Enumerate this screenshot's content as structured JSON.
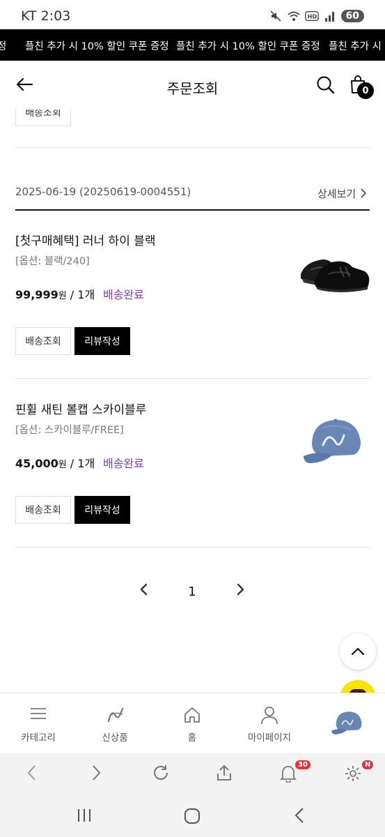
{
  "status_bar": {
    "time": "KT 2:03",
    "battery": "60"
  },
  "marquee": {
    "text": "플친 추가 시 10% 할인 쿠폰 증정",
    "left_fragment": "정",
    "right_fragment": "플친 추가 시 1"
  },
  "header": {
    "title": "주문조회",
    "cart_count": "0"
  },
  "top_partial_button": "배송조회",
  "order": {
    "date_label": "2025-06-19 (20250619-0004551)",
    "detail_link": "상세보기"
  },
  "items": [
    {
      "name": "[첫구매혜택] 러너 하이 블랙",
      "option": "[옵션: 블랙/240]",
      "price": "99,999",
      "currency": "원",
      "qty": " / 1개",
      "status": "배송완료",
      "track_label": "배송조회",
      "review_label": "리뷰작성"
    },
    {
      "name": "핀휠 새틴 볼캡 스카이블루",
      "option": "[옵션: 스카이블루/FREE]",
      "price": "45,000",
      "currency": "원",
      "qty": " / 1개",
      "status": "배송완료",
      "track_label": "배송조회",
      "review_label": "리뷰작성"
    }
  ],
  "pagination": {
    "current": "1"
  },
  "bottom_nav": [
    {
      "label": "카테고리",
      "icon": "menu-icon"
    },
    {
      "label": "신상품",
      "icon": "brand-logo-icon"
    },
    {
      "label": "홈",
      "icon": "home-icon"
    },
    {
      "label": "마이페이지",
      "icon": "person-icon"
    },
    {
      "label": "",
      "icon": "recent-product-thumbnail"
    }
  ],
  "browser_bar": {
    "notification_count": "30",
    "settings_badge": "N"
  },
  "colors": {
    "status_purple": "#7b3fa0",
    "marquee_bg": "#000000",
    "kakao_yellow": "#fae100"
  }
}
